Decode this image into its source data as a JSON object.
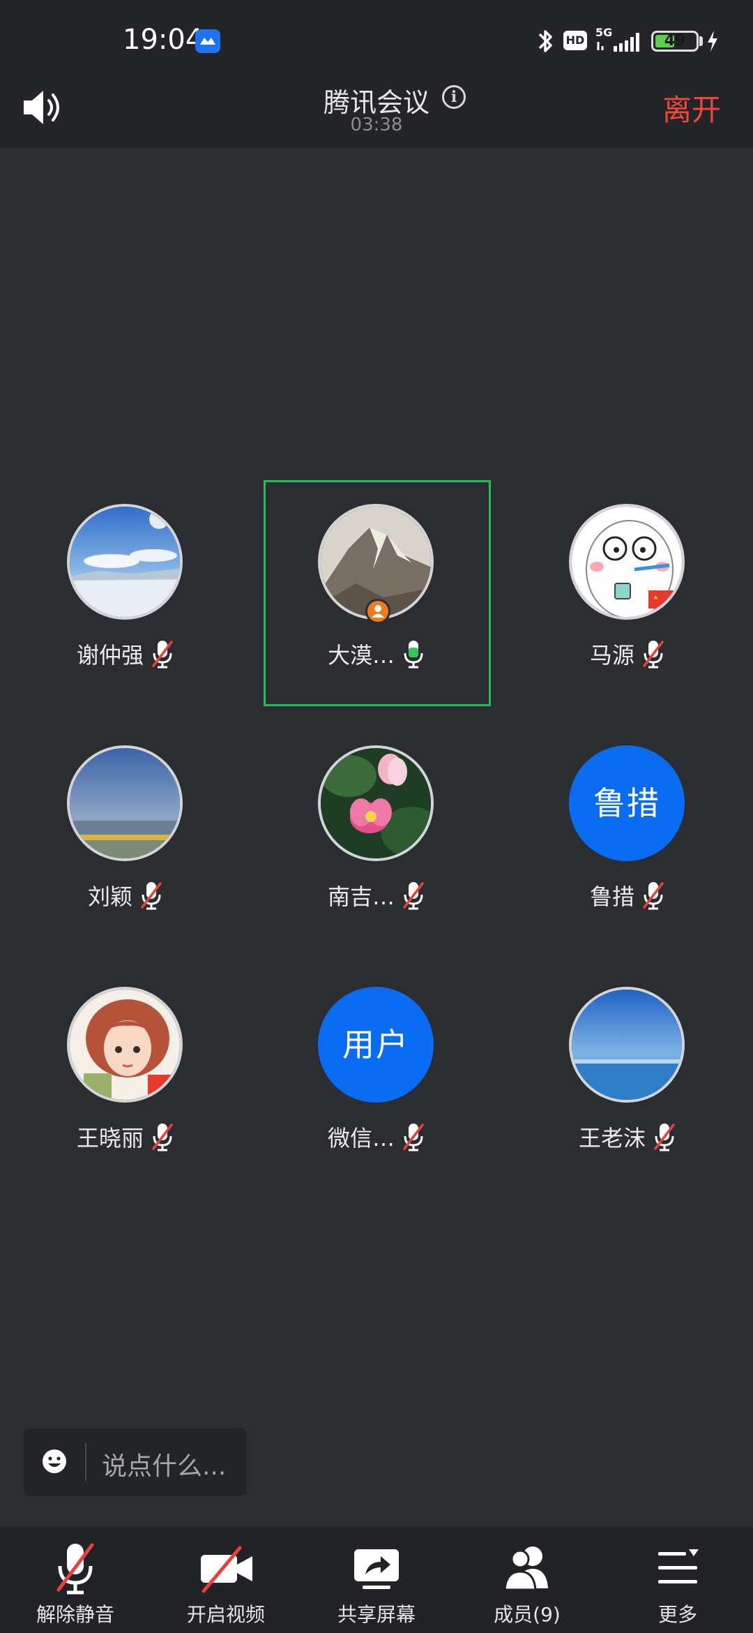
{
  "status_bar": {
    "time": "19:04",
    "hd_label": "HD",
    "network_label": "5G",
    "battery_level": 49,
    "battery_text": "49"
  },
  "header": {
    "title": "腾讯会议",
    "timer": "03:38",
    "leave_label": "离开",
    "icons": {
      "speaker": "speaker-icon",
      "info": "info-icon"
    }
  },
  "participants": [
    {
      "name": "谢仲强",
      "mic": "muted",
      "avatar": "photo-snowfield"
    },
    {
      "name": "大漠…",
      "mic": "active",
      "avatar": "photo-mountain",
      "speaking": true,
      "host": true
    },
    {
      "name": "马源",
      "mic": "muted",
      "avatar": "photo-cartoon-egg"
    },
    {
      "name": "刘颖",
      "mic": "muted",
      "avatar": "photo-lake"
    },
    {
      "name": "南吉…",
      "mic": "muted",
      "avatar": "photo-lotus"
    },
    {
      "name": "鲁措",
      "mic": "muted",
      "avatar": "initials",
      "initials": "鲁措"
    },
    {
      "name": "王晓丽",
      "mic": "muted",
      "avatar": "photo-cartoon-girl"
    },
    {
      "name": "微信…",
      "mic": "muted",
      "avatar": "initials",
      "initials": "用户"
    },
    {
      "name": "王老沫",
      "mic": "muted",
      "avatar": "photo-sea"
    }
  ],
  "chat": {
    "placeholder": "说点什么..."
  },
  "toolbar": [
    {
      "label": "解除静音",
      "icon": "mic-muted-icon"
    },
    {
      "label": "开启视频",
      "icon": "video-off-icon"
    },
    {
      "label": "共享屏幕",
      "icon": "share-screen-icon"
    },
    {
      "label": "成员(9)",
      "icon": "members-icon"
    },
    {
      "label": "更多",
      "icon": "more-menu-icon"
    }
  ],
  "colors": {
    "background": "#2b2d31",
    "bar": "#242528",
    "leave": "#f0463c",
    "accent_blue": "#0a6cf0",
    "speaking_green": "#1fbf5a",
    "host_orange": "#f07a1e"
  }
}
